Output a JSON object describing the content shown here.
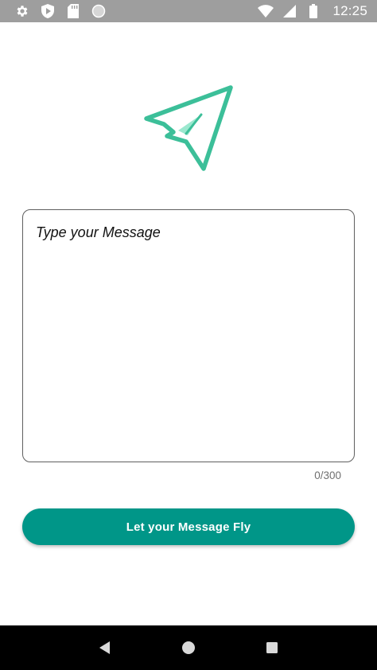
{
  "status_bar": {
    "time": "12:25",
    "icons": [
      "settings-icon",
      "shield-play-icon",
      "sd-card-icon",
      "circle-icon",
      "wifi-icon",
      "signal-icon",
      "battery-icon"
    ]
  },
  "logo": {
    "icon": "paper-plane-icon"
  },
  "message": {
    "placeholder": "Type your Message",
    "value": "",
    "counter": "0/300"
  },
  "action": {
    "label": "Let your Message Fly"
  },
  "nav_bar": {
    "icons": [
      "back-icon",
      "home-icon",
      "recents-icon"
    ]
  },
  "colors": {
    "status_bar": "#9e9e9e",
    "accent": "#009688",
    "logo_green": "#3cbf99",
    "logo_light": "#9be8cf",
    "nav_bar": "#000000"
  }
}
